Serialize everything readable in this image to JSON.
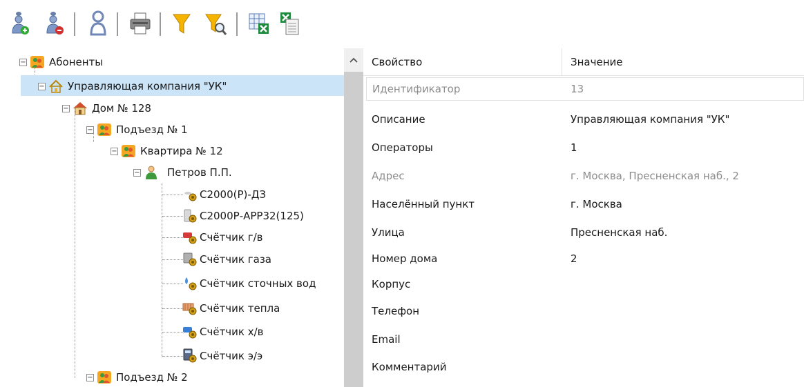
{
  "toolbar": {
    "buttons": [
      {
        "name": "add-user-icon",
        "accent": "#2eaa2e"
      },
      {
        "name": "remove-user-icon",
        "accent": "#d23030"
      },
      {
        "name": "user-icon"
      },
      {
        "name": "print-icon"
      },
      {
        "name": "filter-icon",
        "accent": "#f0a800"
      },
      {
        "name": "filter-search-icon",
        "accent": "#f0a800"
      },
      {
        "name": "export-excel-icon",
        "accent": "#1e8a3c"
      },
      {
        "name": "import-excel-icon",
        "accent": "#1e8a3c"
      }
    ]
  },
  "tree": {
    "root": {
      "label": "Абоненты",
      "icon": "group-icon"
    },
    "company": {
      "label": "Управляющая компания \"УК\"",
      "icon": "house-outline-icon"
    },
    "house": {
      "label": "Дом № 128",
      "icon": "house-icon"
    },
    "entrance1": {
      "label": "Подъезд № 1",
      "icon": "group-icon"
    },
    "flat": {
      "label": "Квартира № 12",
      "icon": "group-icon"
    },
    "person": {
      "label": "Петров П.П.",
      "icon": "person-icon"
    },
    "devices": [
      {
        "label": "С2000(Р)-ДЗ",
        "icon": "sensor-device-icon"
      },
      {
        "label": "С2000Р-АРР32(125)",
        "icon": "radio-device-icon"
      },
      {
        "label": "Счётчик г/в",
        "icon": "hot-water-meter-icon"
      },
      {
        "label": "Счётчик газа",
        "icon": "gas-meter-icon"
      },
      {
        "label": "Счётчик сточных вод",
        "icon": "wastewater-meter-icon"
      },
      {
        "label": "Счётчик тепла",
        "icon": "heat-meter-icon"
      },
      {
        "label": "Счётчик х/в",
        "icon": "cold-water-meter-icon"
      },
      {
        "label": "Счётчик э/э",
        "icon": "electricity-meter-icon"
      }
    ],
    "entrance2": {
      "label": "Подъезд № 2",
      "icon": "group-icon"
    }
  },
  "grid": {
    "header": {
      "property": "Свойство",
      "value": "Значение"
    },
    "rows": [
      {
        "name": "Идентификатор",
        "value": "13",
        "readonly": true
      },
      {
        "name": "Описание",
        "value": "Управляющая компания \"УК\"",
        "readonly": false
      },
      {
        "name": "Операторы",
        "value": "1",
        "readonly": false
      },
      {
        "name": "Адрес",
        "value": "г. Москва, Пресненская наб., 2",
        "readonly": true
      },
      {
        "name": "Населённый пункт",
        "value": "г. Москва",
        "readonly": false
      },
      {
        "name": "Улица",
        "value": "Пресненская наб.",
        "readonly": false
      },
      {
        "name": "Номер дома",
        "value": "2",
        "readonly": false
      },
      {
        "name": "Корпус",
        "value": "",
        "readonly": false
      },
      {
        "name": "Телефон",
        "value": "",
        "readonly": false
      },
      {
        "name": "Email",
        "value": "",
        "readonly": false
      },
      {
        "name": "Комментарий",
        "value": "",
        "readonly": false
      }
    ]
  },
  "colors": {
    "selection": "#cce4f7",
    "scrollbar_thumb": "#cdcdcd",
    "readonly_text": "#8c8c8c"
  }
}
